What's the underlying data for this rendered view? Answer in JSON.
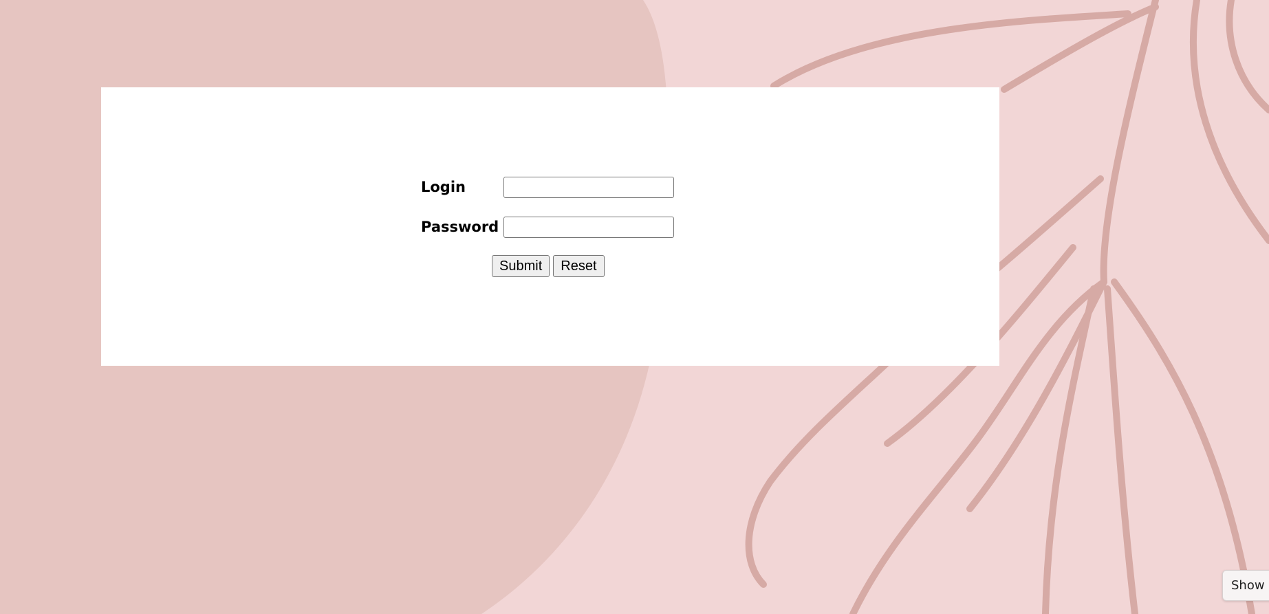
{
  "form": {
    "login_label": "Login",
    "login_value": "",
    "password_label": "Password",
    "password_value": "",
    "submit_label": "Submit",
    "reset_label": "Reset"
  },
  "corner_popup": {
    "text": "Show c"
  },
  "colors": {
    "background": "#f2d6d6",
    "blob": "#e6c5c1",
    "leaf_stroke": "#d6aaa5",
    "panel": "#ffffff"
  }
}
